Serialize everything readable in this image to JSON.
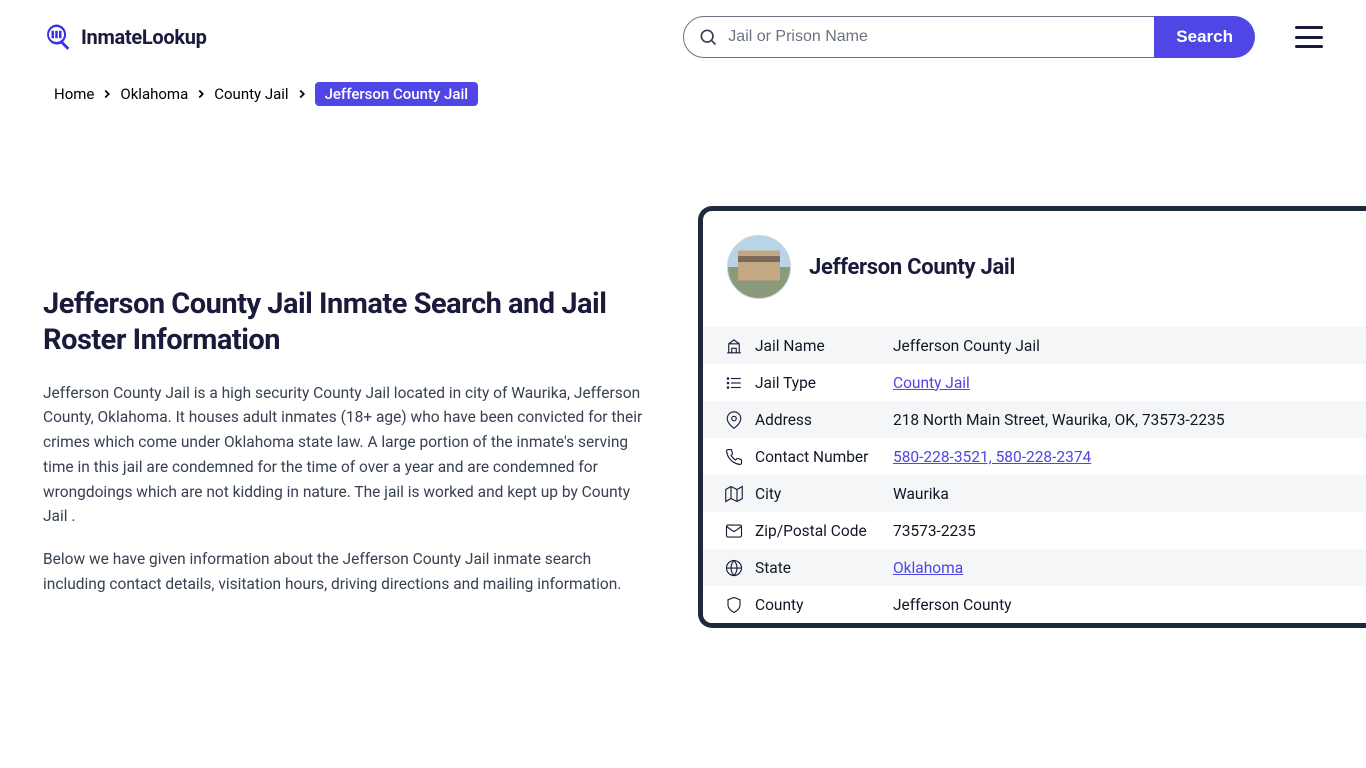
{
  "logo": {
    "text": "InmateLookup"
  },
  "search": {
    "placeholder": "Jail or Prison Name",
    "button": "Search"
  },
  "breadcrumbs": [
    {
      "label": "Home",
      "active": false
    },
    {
      "label": "Oklahoma",
      "active": false
    },
    {
      "label": "County Jail",
      "active": false
    },
    {
      "label": "Jefferson County Jail",
      "active": true
    }
  ],
  "main": {
    "title": "Jefferson County Jail Inmate Search and Jail Roster Information",
    "para1": "Jefferson County Jail is a high security County Jail located in city of Waurika, Jefferson County, Oklahoma. It houses adult inmates (18+ age) who have been convicted for their crimes which come under Oklahoma state law. A large portion of the inmate's serving time in this jail are condemned for the time of over a year and are condemned for wrongdoings which are not kidding in nature. The jail is worked and kept up by County Jail .",
    "para2": "Below we have given information about the Jefferson County Jail inmate search including contact details, visitation hours, driving directions and mailing information."
  },
  "card": {
    "title": "Jefferson County Jail",
    "rows": [
      {
        "icon": "institution",
        "label": "Jail Name",
        "value": "Jefferson County Jail",
        "link": false
      },
      {
        "icon": "list",
        "label": "Jail Type",
        "value": "County Jail",
        "link": true
      },
      {
        "icon": "mappin",
        "label": "Address",
        "value": "218 North Main Street, Waurika, OK, 73573-2235",
        "link": false
      },
      {
        "icon": "phone",
        "label": "Contact Number",
        "value": "580-228-3521, 580-228-2374",
        "link": true
      },
      {
        "icon": "map",
        "label": "City",
        "value": "Waurika",
        "link": false
      },
      {
        "icon": "envelope",
        "label": "Zip/Postal Code",
        "value": "73573-2235",
        "link": false
      },
      {
        "icon": "globe",
        "label": "State",
        "value": "Oklahoma",
        "link": true
      },
      {
        "icon": "shield",
        "label": "County",
        "value": "Jefferson County",
        "link": false
      }
    ]
  }
}
